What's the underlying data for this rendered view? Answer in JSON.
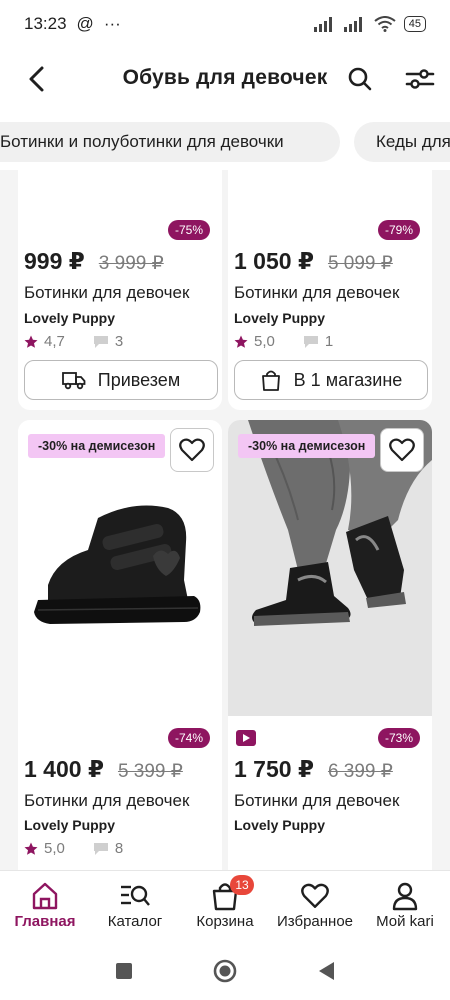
{
  "status_bar": {
    "time": "13:23",
    "at_sign": "@",
    "dots": "···",
    "battery": "45"
  },
  "header": {
    "title": "Обувь для девочек"
  },
  "chips": [
    {
      "label": "Ботинки и полуботинки для девочки"
    },
    {
      "label": "Кеды для"
    }
  ],
  "products": [
    {
      "discount": "-75%",
      "price": "999 ₽",
      "old_price": "3 999 ₽",
      "name": "Ботинки для девочек",
      "brand": "Lovely Puppy",
      "rating": "4,7",
      "comments": "3",
      "action": "Привезем"
    },
    {
      "discount": "-79%",
      "price": "1 050 ₽",
      "old_price": "5 099 ₽",
      "name": "Ботинки для девочек",
      "brand": "Lovely Puppy",
      "rating": "5,0",
      "comments": "1",
      "action": "В 1 магазине"
    },
    {
      "promo": "-30% на демисезон",
      "discount": "-74%",
      "price": "1 400 ₽",
      "old_price": "5 399 ₽",
      "name": "Ботинки для девочек",
      "brand": "Lovely Puppy",
      "rating": "5,0",
      "comments": "8"
    },
    {
      "promo": "-30% на демисезон",
      "discount": "-73%",
      "price": "1 750 ₽",
      "old_price": "6 399 ₽",
      "name": "Ботинки для девочек",
      "brand": "Lovely Puppy"
    }
  ],
  "bottom_nav": [
    {
      "label": "Главная"
    },
    {
      "label": "Каталог"
    },
    {
      "label": "Корзина",
      "badge": "13"
    },
    {
      "label": "Избранное"
    },
    {
      "label": "Мой kari"
    }
  ],
  "colors": {
    "accent": "#8e1560",
    "promo_bg": "#f3c6f4",
    "badge": "#e8473a"
  }
}
